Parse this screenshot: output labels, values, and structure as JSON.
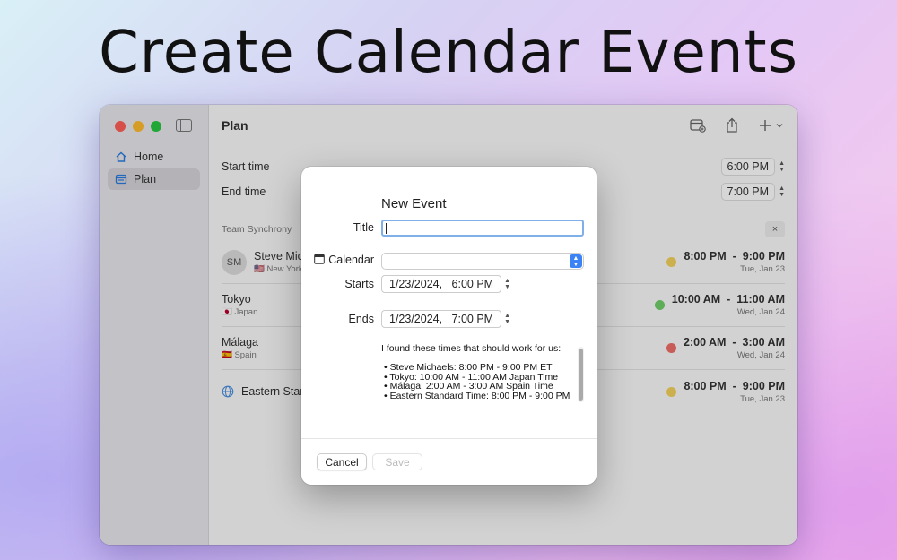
{
  "headline": "Create Calendar Events",
  "colors": {
    "accent": "#2a7de1",
    "dot_yellow": "#f3d25c",
    "dot_green": "#6fcf6a",
    "dot_red": "#ee6f67"
  },
  "sidebar": {
    "items": [
      {
        "label": "Home",
        "icon": "house-icon"
      },
      {
        "label": "Plan",
        "icon": "calendar-list-icon"
      }
    ]
  },
  "toolbar": {
    "title": "Plan",
    "icons": [
      "calendar-add-icon",
      "share-icon",
      "plus-icon",
      "chevron-down-icon"
    ]
  },
  "fields": {
    "start_label": "Start time",
    "start_value": "6:00 PM",
    "end_label": "End time",
    "end_value": "7:00 PM"
  },
  "section": {
    "title": "Team Synchrony",
    "close": "×"
  },
  "timezones": [
    {
      "initials": "SM",
      "name": "Steve Mich",
      "sub": "🇺🇸 New York",
      "start": "8:00 PM",
      "end": "9:00 PM",
      "date": "Tue, Jan 23",
      "dot": "yellow"
    },
    {
      "name": "Tokyo",
      "sub": "🇯🇵 Japan",
      "start": "10:00 AM",
      "end": "11:00 AM",
      "date": "Wed, Jan 24",
      "dot": "green"
    },
    {
      "name": "Málaga",
      "sub": "🇪🇸 Spain",
      "start": "2:00 AM",
      "end": "3:00 AM",
      "date": "Wed, Jan 24",
      "dot": "red"
    },
    {
      "name": "Eastern Stand",
      "sub": "",
      "start": "8:00 PM",
      "end": "9:00 PM",
      "date": "Tue, Jan 23",
      "dot": "yellow"
    }
  ],
  "dialog": {
    "title": "New Event",
    "title_label": "Title",
    "title_value": "",
    "calendar_label": "Calendar",
    "calendar_value": "",
    "starts_label": "Starts",
    "starts_date": "1/23/2024,",
    "starts_time": "6:00 PM",
    "ends_label": "Ends",
    "ends_date": "1/23/2024,",
    "ends_time": "7:00 PM",
    "notes": [
      "I found these times that should work for us:",
      "",
      "• Steve Michaels: 8:00 PM - 9:00 PM ET",
      "• Tokyo: 10:00 AM - 11:00 AM Japan Time",
      "• Málaga: 2:00 AM - 3:00 AM Spain Time",
      "• Eastern Standard Time: 8:00 PM - 9:00 PM"
    ],
    "cancel_label": "Cancel",
    "save_label": "Save"
  }
}
